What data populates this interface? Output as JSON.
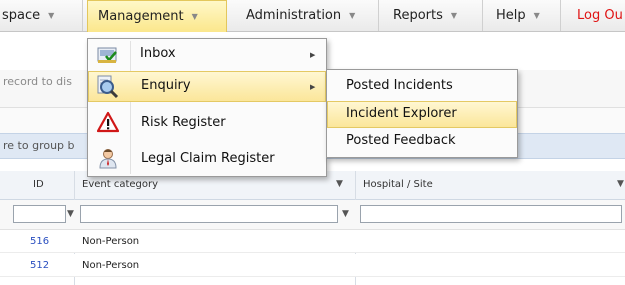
{
  "menubar": {
    "items": [
      {
        "label": "space",
        "caret": "▼"
      },
      {
        "label": "Management",
        "caret": "▼"
      },
      {
        "label": "Administration",
        "caret": "▼"
      },
      {
        "label": "Reports",
        "caret": "▼"
      },
      {
        "label": "Help",
        "caret": "▼"
      },
      {
        "label": "Log Ou"
      }
    ],
    "active_item": "Management"
  },
  "page": {
    "hint_text": "record to dis",
    "group_text": "re to group b",
    "columns": [
      {
        "label": "ID"
      },
      {
        "label": "Event category"
      },
      {
        "label": "Hospital / Site"
      }
    ],
    "rows": [
      {
        "id": "516",
        "event_category": "Non-Person"
      },
      {
        "id": "512",
        "event_category": "Non-Person"
      }
    ]
  },
  "management_menu": {
    "items": [
      {
        "label": "Inbox",
        "icon": "inbox-icon",
        "has_submenu": true
      },
      {
        "label": "Enquiry",
        "icon": "magnifier-icon",
        "has_submenu": true,
        "highlighted": true
      },
      {
        "label": "Risk Register",
        "icon": "warning-icon",
        "has_submenu": false
      },
      {
        "label": "Legal Claim Register",
        "icon": "person-icon",
        "has_submenu": false
      }
    ],
    "submenu_arrow": "▶"
  },
  "enquiry_submenu": {
    "items": [
      {
        "label": "Posted Incidents"
      },
      {
        "label": "Incident Explorer",
        "highlighted": true
      },
      {
        "label": "Posted Feedback"
      }
    ]
  },
  "colors": {
    "accent_highlight": "#fbe69a",
    "logout": "#e01414",
    "link_id": "#2a4fc0"
  }
}
